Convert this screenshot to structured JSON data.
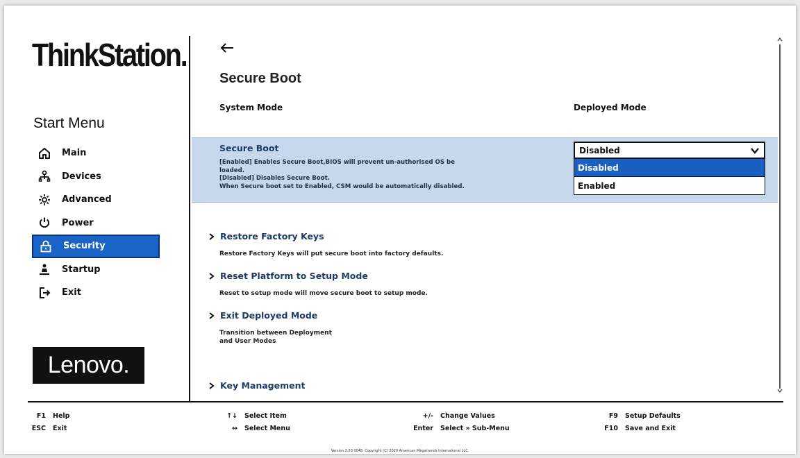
{
  "sidebar": {
    "brand": "ThinkStation.",
    "title": "Start Menu",
    "items": [
      {
        "label": "Main",
        "icon": "home-icon"
      },
      {
        "label": "Devices",
        "icon": "devices-icon"
      },
      {
        "label": "Advanced",
        "icon": "advanced-icon"
      },
      {
        "label": "Power",
        "icon": "power-icon"
      },
      {
        "label": "Security",
        "icon": "lock-icon",
        "active": true
      },
      {
        "label": "Startup",
        "icon": "startup-icon"
      },
      {
        "label": "Exit",
        "icon": "exit-icon"
      }
    ],
    "vendor_logo": "Lenovo."
  },
  "main": {
    "title": "Secure Boot",
    "system_mode": {
      "label": "System Mode",
      "value": "Deployed Mode"
    },
    "secure_boot": {
      "label": "Secure Boot",
      "description": [
        "[Enabled] Enables Secure Boot,BIOS will prevent un-authorised OS be",
        "loaded.",
        "[Disabled] Disables Secure Boot.",
        "When Secure boot set to Enabled, CSM would be automatically disabled."
      ],
      "selected": "Disabled",
      "options": [
        "Disabled",
        "Enabled"
      ]
    },
    "links": [
      {
        "label": "Restore Factory Keys",
        "description": [
          "Restore Factory Keys will put secure boot into factory defaults."
        ]
      },
      {
        "label": "Reset Platform to Setup Mode",
        "description": [
          "Reset to setup mode will move secure boot to setup mode."
        ]
      },
      {
        "label": "Exit Deployed Mode",
        "description": [
          "Transition between Deployment",
          "and User Modes"
        ]
      },
      {
        "label": "Key Management",
        "description": []
      }
    ]
  },
  "footer": {
    "col1": [
      {
        "key": "F1",
        "action": "Help"
      },
      {
        "key": "ESC",
        "action": "Exit"
      }
    ],
    "col2": [
      {
        "key": "↑↓",
        "action": "Select Item"
      },
      {
        "key": "↔",
        "action": "Select Menu"
      }
    ],
    "col3": [
      {
        "key": "+/-",
        "action": "Change Values"
      },
      {
        "key": "Enter",
        "action": "Select » Sub-Menu"
      }
    ],
    "col4": [
      {
        "key": "F9",
        "action": "Setup Defaults"
      },
      {
        "key": "F10",
        "action": "Save and Exit"
      }
    ],
    "version": "Version 2.20 0048. Copyright (C) 2020 American Megatrends International LLC."
  },
  "colors": {
    "accent": "#1a63c7",
    "panel": "#c7d8ec",
    "text": "#111111"
  }
}
